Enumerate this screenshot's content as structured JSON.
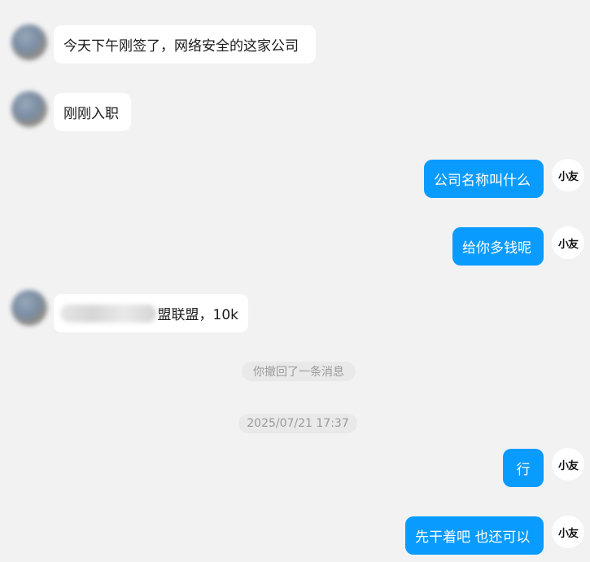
{
  "contact_self": {
    "avatar_text": "小友"
  },
  "messages": [
    {
      "id": "m1",
      "side": "left",
      "text": "今天下午刚签了，网络安全的这家公司"
    },
    {
      "id": "m2",
      "side": "left",
      "text": "刚刚入职"
    },
    {
      "id": "m3",
      "side": "right",
      "text": "公司名称叫什么"
    },
    {
      "id": "m4",
      "side": "right",
      "text": "给你多钱呢"
    },
    {
      "id": "m5",
      "side": "left",
      "text": "盟联盟，10k"
    },
    {
      "id": "m6",
      "side": "right",
      "text": "行"
    },
    {
      "id": "m7",
      "side": "right",
      "text": "先干着吧 也还可以"
    }
  ],
  "system": {
    "recall_notice": "你撤回了一条消息",
    "timestamp": "2025/07/21 17:37"
  }
}
